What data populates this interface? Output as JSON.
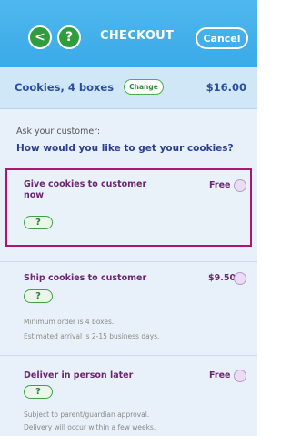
{
  "header": {
    "back_icon": "chevron-left-icon",
    "back_glyph": "<",
    "help_glyph": "?",
    "title": "CHECKOUT",
    "cancel_label": "Cancel"
  },
  "summary": {
    "label": "Cookies, 4 boxes",
    "change_label": "Change",
    "price": "$16.00"
  },
  "question": {
    "ask": "Ask your customer:",
    "text": "How would you like to get your cookies?"
  },
  "options": [
    {
      "title": "Give cookies to customer now",
      "price": "Free",
      "help_glyph": "?",
      "selected": true
    },
    {
      "title": "Ship cookies to customer",
      "price": "$9.50",
      "help_glyph": "?",
      "note_line1": "Minimum order is 4 boxes.",
      "note_line2": "Estimated arrival is 2-15 business days."
    },
    {
      "title": "Deliver in person later",
      "price": "Free",
      "help_glyph": "?",
      "note_line1": "Subject to parent/guardian approval.",
      "note_line2": "Delivery will occur within a few weeks."
    }
  ],
  "colors": {
    "header": "#3aaae8",
    "accent_green": "#2f9c3e",
    "selected_border": "#b0156d",
    "option_title": "#6b2572"
  }
}
